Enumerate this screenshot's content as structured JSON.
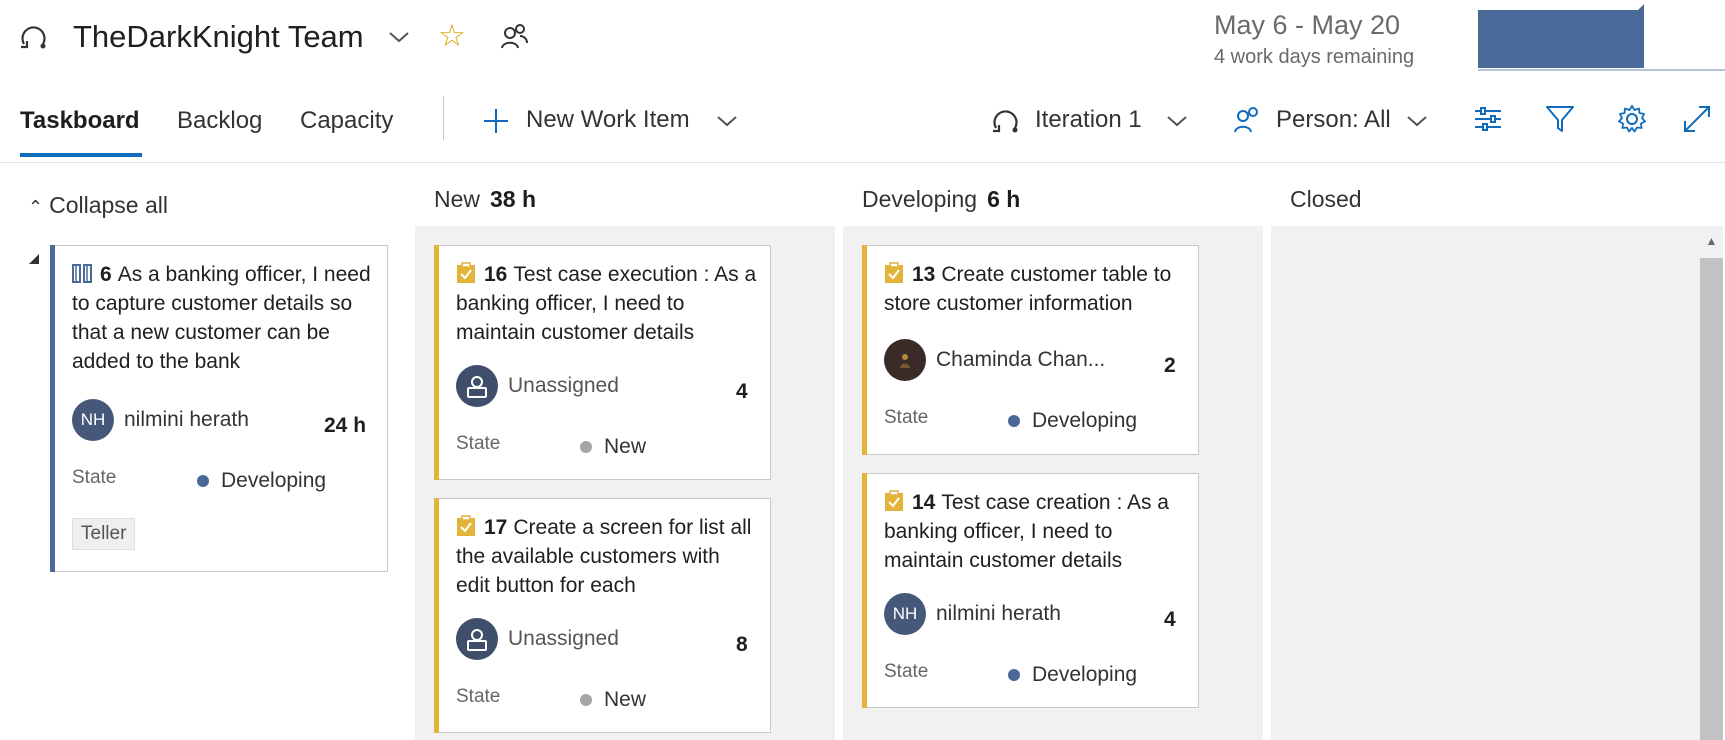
{
  "header": {
    "team_name": "TheDarkKnight Team",
    "iteration_dates": "May 6 - May 20",
    "work_days_remaining": "4 work days remaining",
    "accent_color": "#4a6898",
    "star_color": "#e0a20b"
  },
  "toolbar": {
    "tabs": [
      {
        "label": "Taskboard",
        "active": true
      },
      {
        "label": "Backlog",
        "active": false
      },
      {
        "label": "Capacity",
        "active": false
      }
    ],
    "new_work_item_label": "New Work Item",
    "iteration_label": "Iteration 1",
    "person_filter_label": "Person: All",
    "icons": [
      "iteration-icon",
      "person-icon",
      "settings-sliders-icon",
      "filter-icon",
      "gear-icon",
      "fullscreen-icon"
    ]
  },
  "board": {
    "collapse_all_label": "Collapse all",
    "columns": [
      {
        "name": "New",
        "hours": "38 h"
      },
      {
        "name": "Developing",
        "hours": "6 h"
      },
      {
        "name": "Closed",
        "hours": ""
      }
    ],
    "backlog_item": {
      "id": "6",
      "title": "As a banking officer, I need to capture customer details so that a new customer can be added to the bank",
      "assignee_initials": "NH",
      "assignee": "nilmini herath",
      "hours": "24 h",
      "state_label": "State",
      "state": "Developing",
      "tag": "Teller"
    },
    "cards": [
      {
        "id": "16",
        "title": "Test case execution : As a banking officer, I need to maintain customer details",
        "assignee": "Unassigned",
        "hours": "4",
        "state_label": "State",
        "state": "New",
        "column": "New"
      },
      {
        "id": "17",
        "title": "Create a screen for list all the available customers with edit button for each",
        "assignee": "Unassigned",
        "hours": "8",
        "state_label": "State",
        "state": "New",
        "column": "New"
      },
      {
        "id": "13",
        "title": "Create customer table to store customer information",
        "assignee": "Chaminda Chan...",
        "hours": "2",
        "state_label": "State",
        "state": "Developing",
        "column": "Developing"
      },
      {
        "id": "14",
        "title": "Test case creation : As a banking officer, I need to maintain customer details",
        "assignee_initials": "NH",
        "assignee": "nilmini herath",
        "hours": "4",
        "state_label": "State",
        "state": "Developing",
        "column": "Developing"
      }
    ],
    "colors": {
      "task_bar": "#e2b43a",
      "story_bar": "#4a6898",
      "state_new": "#a6a6a6",
      "state_developing": "#4a6898"
    }
  }
}
